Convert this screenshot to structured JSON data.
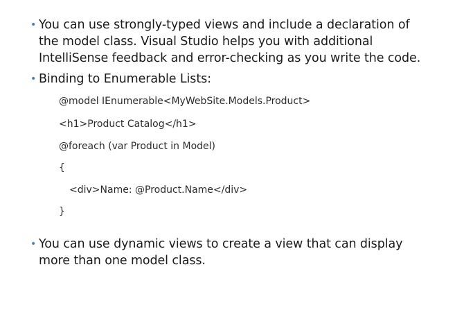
{
  "bullets": [
    "You can use strongly-typed views and include a declaration of\nthe model class. Visual Studio helps you with additional\nIntelliSense feedback and error-checking as you write the code.",
    "Binding to Enumerable Lists:",
    "You can use dynamic views to create a view that can display\nmore than one model class."
  ],
  "bullet_marker": "•",
  "code": [
    "@model IEnumerable<MyWebSite.Models.Product>",
    "<h1>Product Catalog</h1>",
    "@foreach (var Product in Model)",
    "{",
    "<div>Name: @Product.Name</div>",
    "}"
  ],
  "colors": {
    "bullet_marker": "#4a7ebb",
    "text": "#1a1a1a"
  }
}
